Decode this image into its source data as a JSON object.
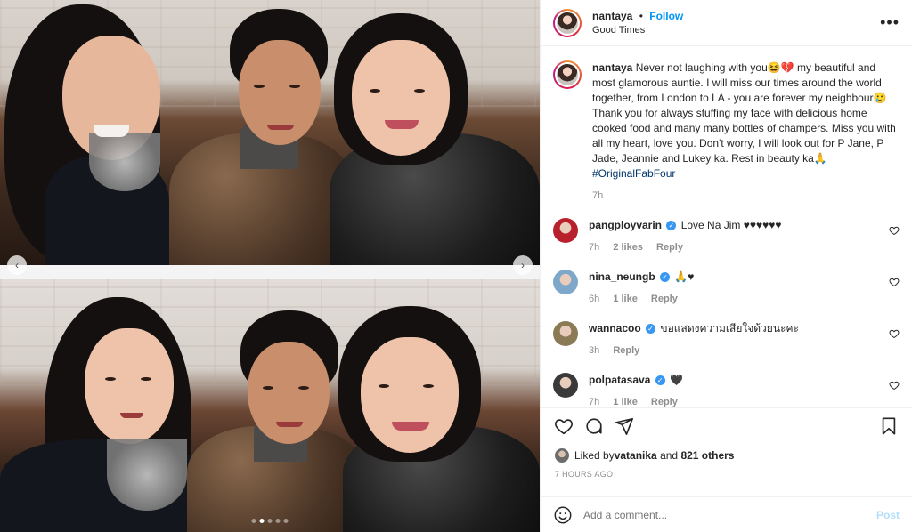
{
  "post": {
    "username": "nantaya",
    "follow_label": "Follow",
    "location": "Good Times",
    "more_label": "•••",
    "bullet": "•"
  },
  "caption": {
    "username": "nantaya",
    "text_1": " Never not laughing with you😆💔 my beautiful and most glamorous auntie. I will miss our times around the world together, from London to LA - you are forever my neighbour🥲 Thank you for always stuffing my face with delicious home cooked food and many many bottles of champers. Miss you with all my heart, love you. Don't worry, I will look out for P Jane, P Jade, Jeannie and Lukey ka. Rest in beauty ka🙏",
    "hashtag": "#OriginalFabFour",
    "time": "7h"
  },
  "comments": [
    {
      "username": "pangployvarin",
      "text": "Love Na Jim ♥♥♥♥♥♥",
      "time": "7h",
      "likes": "2 likes",
      "reply": "Reply",
      "verified": true,
      "avatar_color": "#b8212b"
    },
    {
      "username": "nina_neungb",
      "text": "🙏♥",
      "time": "6h",
      "likes": "1 like",
      "reply": "Reply",
      "verified": true,
      "avatar_color": "#7fa7c9"
    },
    {
      "username": "wannacoo",
      "text": "ขอแสดงความเสียใจด้วยนะคะ",
      "time": "3h",
      "likes": "",
      "reply": "Reply",
      "verified": true,
      "avatar_color": "#8a7a56"
    },
    {
      "username": "polpatasava",
      "text": "🖤",
      "time": "7h",
      "likes": "1 like",
      "reply": "Reply",
      "verified": true,
      "avatar_color": "#3a3a3a"
    }
  ],
  "actions": {
    "like_icon": "heart-outline-icon",
    "comment_icon": "comment-icon",
    "share_icon": "send-icon",
    "save_icon": "bookmark-icon"
  },
  "likes": {
    "prefix": "Liked by ",
    "user": "vatanika",
    "middle": " and ",
    "count": "821 others"
  },
  "timestamp": "7 HOURS AGO",
  "add_comment": {
    "placeholder": "Add a comment...",
    "post_label": "Post",
    "emoji_icon": "smiley-icon"
  },
  "carousel": {
    "prev_glyph": "‹",
    "next_glyph": "›",
    "slide_count": 5,
    "active_slide": 2
  },
  "colors": {
    "accent": "#0095f6",
    "hashtag": "#00376b",
    "muted": "#8e8e8e",
    "post_disabled": "#b2dffc"
  }
}
